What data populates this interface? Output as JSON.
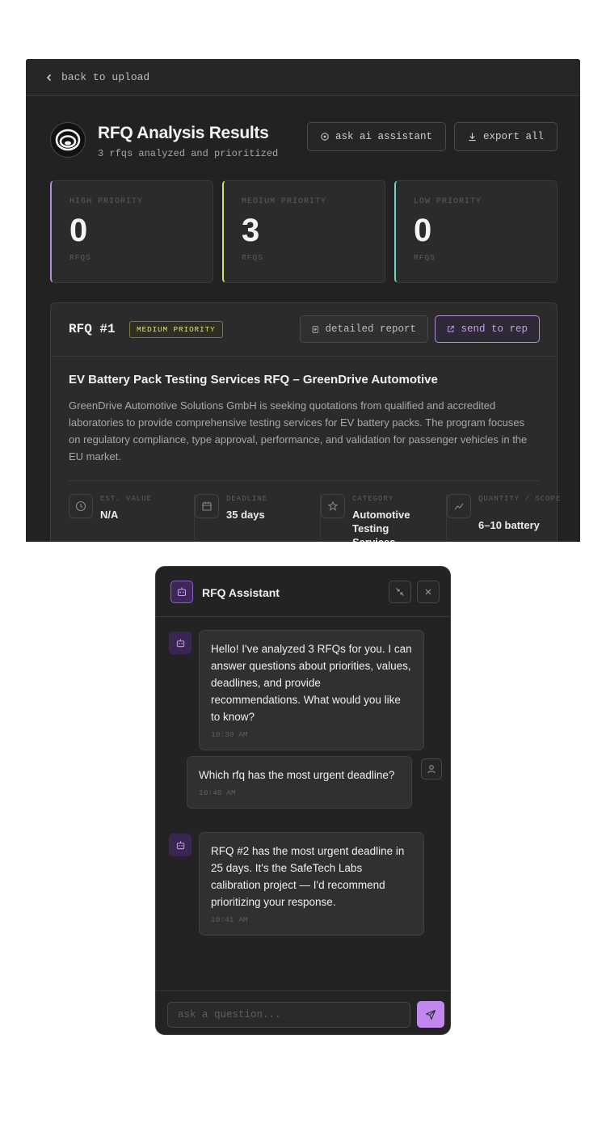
{
  "topbar": {
    "back_label": "back to upload"
  },
  "header": {
    "title": "RFQ Analysis Results",
    "subtitle": "3 rfqs analyzed and prioritized",
    "ask_ai_label": "ask ai assistant",
    "export_label": "export all"
  },
  "stats": [
    {
      "label": "HIGH PRIORITY",
      "value": "0",
      "unit": "RFQS",
      "color": "#b58be0"
    },
    {
      "label": "MEDIUM PRIORITY",
      "value": "3",
      "unit": "RFQS",
      "color": "#d4dc6a"
    },
    {
      "label": "LOW PRIORITY",
      "value": "0",
      "unit": "RFQS",
      "color": "#6fd4c6"
    }
  ],
  "rfq": {
    "id": "RFQ #1",
    "priority_badge": "MEDIUM PRIORITY",
    "report_label": "detailed report",
    "send_label": "send to rep",
    "title": "EV Battery Pack Testing Services RFQ – GreenDrive Automotive",
    "description": "GreenDrive Automotive Solutions GmbH is seeking quotations from qualified and accredited laboratories to provide comprehensive testing services for EV battery packs. The program focuses on regulatory compliance, type approval, performance, and validation for passenger vehicles in the EU market.",
    "meta": [
      {
        "label": "EST. VALUE",
        "value": "N/A",
        "icon": "clock-icon"
      },
      {
        "label": "DEADLINE",
        "value": "35 days",
        "icon": "calendar-icon"
      },
      {
        "label": "CATEGORY",
        "value": "Automotive Testing Services",
        "icon": "star-icon"
      },
      {
        "label": "QUANTITY / SCOPE",
        "value": "6–10 battery",
        "icon": "trend-icon"
      }
    ]
  },
  "chat": {
    "title": "RFQ Assistant",
    "messages": [
      {
        "role": "assistant",
        "text": "Hello! I've analyzed 3 RFQs for you. I can answer questions about priorities, values, deadlines, and provide recommendations. What would you like to know?",
        "time": "10:39 AM"
      },
      {
        "role": "user",
        "text": "Which rfq has the most urgent deadline?",
        "time": "10:40 AM"
      },
      {
        "role": "assistant",
        "text": "RFQ #2 has the most urgent deadline in 25 days. It's the SafeTech Labs calibration project — I'd recommend prioritizing your response.",
        "time": "10:41 AM"
      }
    ],
    "input_placeholder": "ask a question..."
  }
}
